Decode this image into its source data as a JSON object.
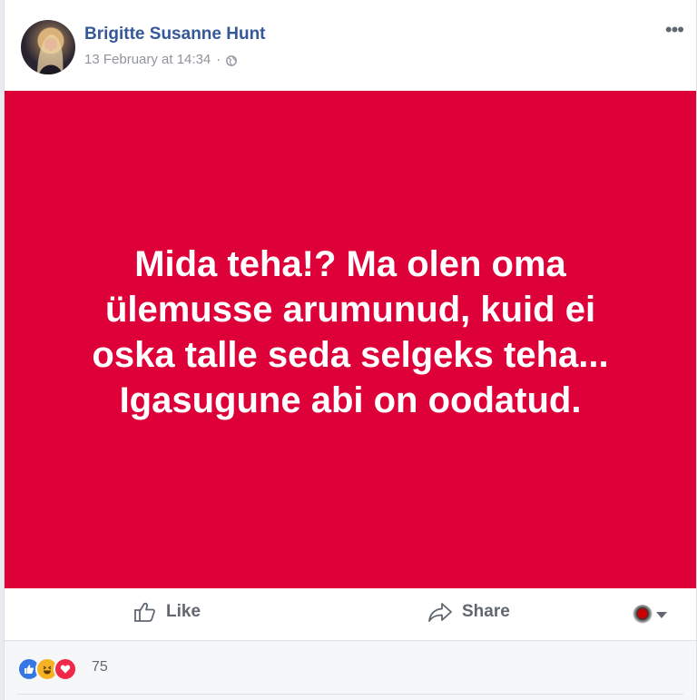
{
  "post": {
    "author": "Brigitte Susanne Hunt",
    "timestamp": "13 February at 14:34",
    "separator": "·",
    "audience_icon": "globe-icon",
    "more_label": "•••",
    "text": "Mida teha!? Ma olen oma ülemusse arumunud, kuid ei oska talle seda selgeks teha... Igasugune abi on oodatud.",
    "background_color": "#dd0039"
  },
  "actions": {
    "like_label": "Like",
    "share_label": "Share"
  },
  "reactions": {
    "icons": [
      "like-icon",
      "haha-icon",
      "love-icon"
    ],
    "count": "75"
  },
  "colors": {
    "author_link": "#365899",
    "meta_text": "#90949c",
    "action_text": "#606770"
  }
}
